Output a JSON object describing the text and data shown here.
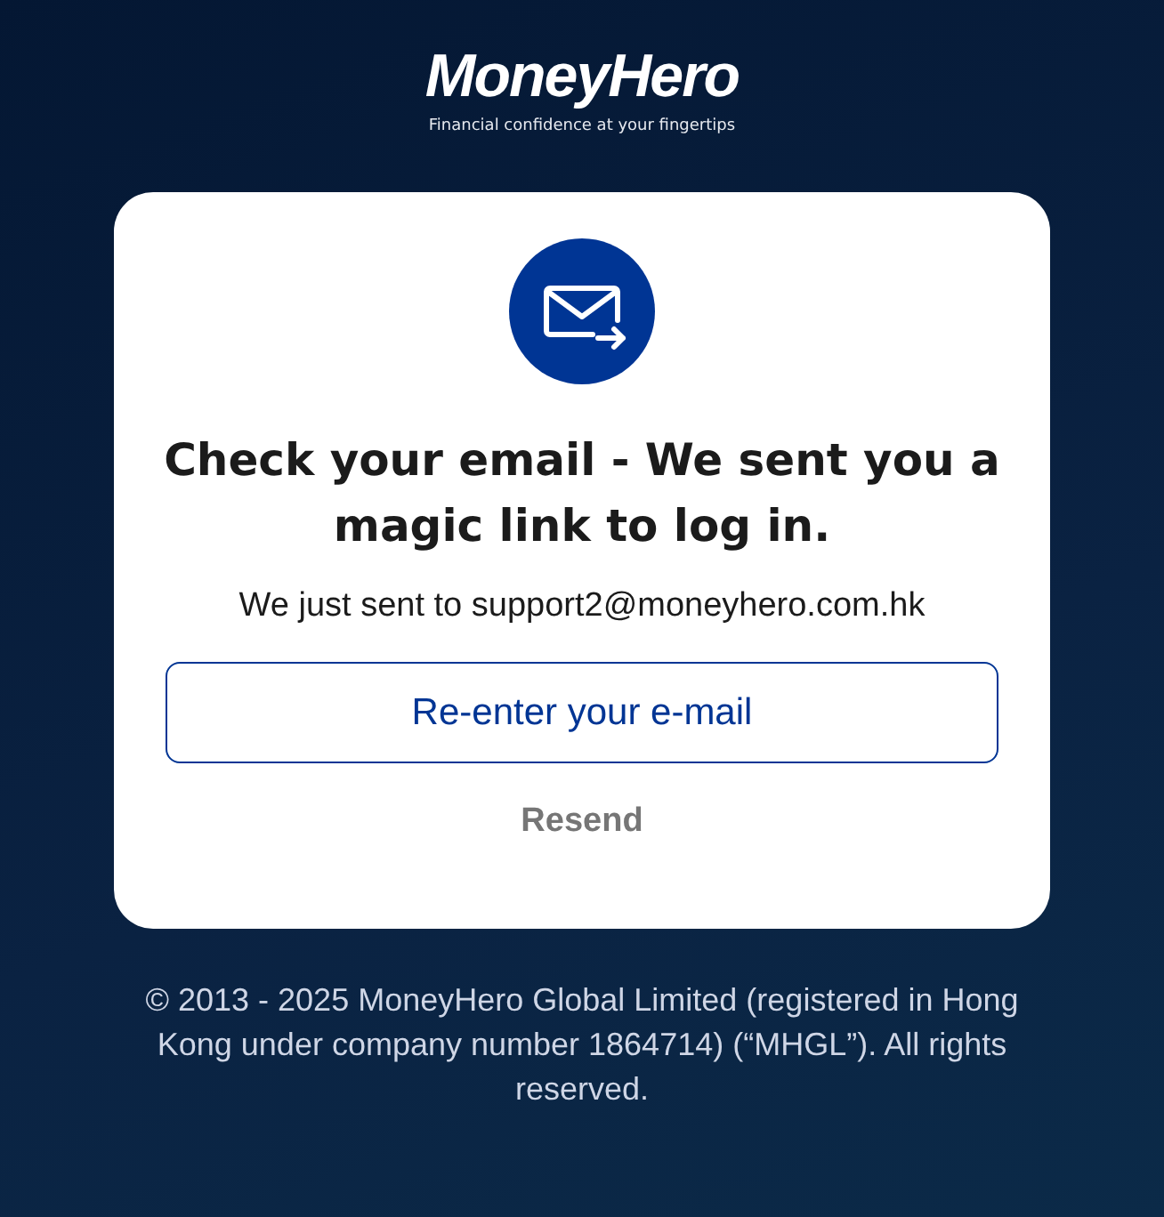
{
  "logo": {
    "name": "MoneyHero",
    "tagline": "Financial confidence at your fingertips"
  },
  "card": {
    "title": "Check your email - We sent you a magic link to log in.",
    "message": "We just sent to support2@moneyhero.com.hk",
    "reenter_button": "Re-enter your e-mail",
    "resend_link": "Resend"
  },
  "footer": "© 2013 - 2025 MoneyHero Global Limited (registered in Hong Kong under company number 1864714) (“MHGL”). All rights reserved."
}
